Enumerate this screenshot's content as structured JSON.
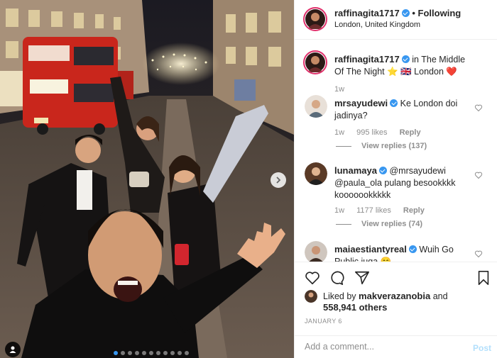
{
  "post": {
    "username": "raffinagita1717",
    "follow_status": "• Following",
    "location": "London, United Kingdom",
    "caption_username": "raffinagita1717",
    "caption_text": "in The Middle Of The Night ⭐ 🇬🇧 London ❤️",
    "caption_time": "1w",
    "likes_prefix": "Liked by",
    "likes_user": "makverazanobia",
    "likes_and": "and",
    "likes_count": "558,941 others",
    "date": "JANUARY 6",
    "photo_count": 11,
    "photo_index": 0
  },
  "comments": [
    {
      "username": "mrsayudewi",
      "text": "Ke London doi jadinya?",
      "time": "1w",
      "likes": "995 likes",
      "reply": "Reply",
      "view_replies": "View replies (137)"
    },
    {
      "username": "lunamaya",
      "text": "@mrsayudewi @paula_ola pulang besookkkk kooooookkkkk",
      "time": "1w",
      "likes": "1177 likes",
      "reply": "Reply",
      "view_replies": "View replies (74)"
    },
    {
      "username": "maiaestiantyreal",
      "text": "Wuih Go Public juga 😄"
    }
  ],
  "composer": {
    "placeholder": "Add a comment...",
    "post_label": "Post"
  },
  "colors": {
    "verified": "#3897f0",
    "accent_blue": "#3897f0",
    "post_disabled": "#b2dffc",
    "muted": "#8e8e8e"
  }
}
